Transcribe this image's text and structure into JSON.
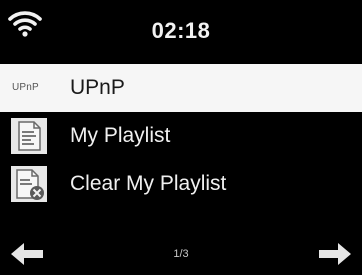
{
  "header": {
    "time": "02:18",
    "wifi_icon": "wifi-icon"
  },
  "menu": {
    "items": [
      {
        "label": "UPnP",
        "logo_text": "UPnP",
        "selected": true
      },
      {
        "label": "My Playlist",
        "icon": "playlist-icon",
        "selected": false
      },
      {
        "label": "Clear My Playlist",
        "icon": "clear-playlist-icon",
        "selected": false
      }
    ]
  },
  "footer": {
    "page": "1/3",
    "left_icon": "arrow-left-icon",
    "right_icon": "arrow-right-icon"
  },
  "colors": {
    "background": "#000000",
    "selected_row": "#f6f6f6",
    "text": "#f0f0f0",
    "selected_text": "#1a1a1a"
  }
}
